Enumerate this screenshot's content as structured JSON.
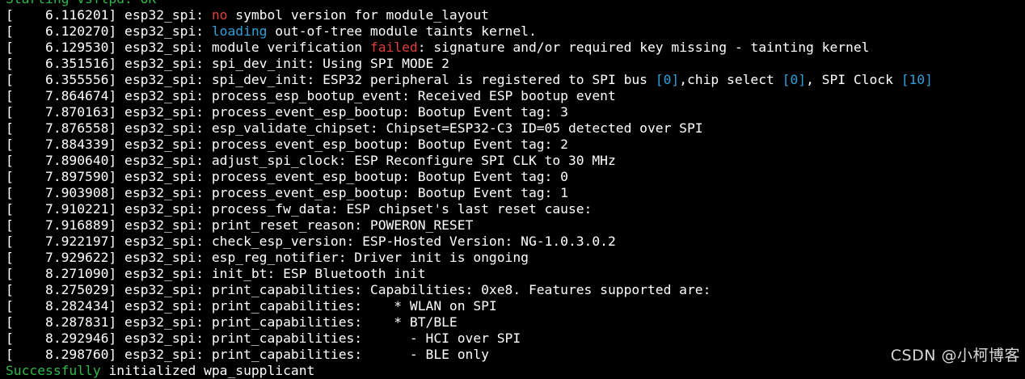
{
  "colors": {
    "background": "#000000",
    "text": "#ffffff",
    "error": "#e04040",
    "info": "#2ea0d8",
    "success": "#2fb84a"
  },
  "lines": [
    [
      {
        "t": "Starting vsftpd: ",
        "c": "green"
      },
      {
        "t": "OK",
        "c": "green"
      }
    ],
    [
      {
        "t": "[    6.116201] esp32_spi: ",
        "c": "normal"
      },
      {
        "t": "no",
        "c": "red"
      },
      {
        "t": " symbol version for module_layout",
        "c": "normal"
      }
    ],
    [
      {
        "t": "[    6.120270] esp32_spi: ",
        "c": "normal"
      },
      {
        "t": "loading",
        "c": "blue"
      },
      {
        "t": " out-of-tree module taints kernel.",
        "c": "normal"
      }
    ],
    [
      {
        "t": "[    6.129530] esp32_spi: module verification ",
        "c": "normal"
      },
      {
        "t": "failed",
        "c": "red"
      },
      {
        "t": ": signature and/or required key missing - tainting kernel",
        "c": "normal"
      }
    ],
    [
      {
        "t": "[    6.351516] esp32_spi: spi_dev_init: Using SPI MODE 2",
        "c": "normal"
      }
    ],
    [
      {
        "t": "[    6.355556] esp32_spi: spi_dev_init: ESP32 peripheral is registered to SPI bus ",
        "c": "normal"
      },
      {
        "t": "[0]",
        "c": "blue"
      },
      {
        "t": ",chip select ",
        "c": "normal"
      },
      {
        "t": "[0]",
        "c": "blue"
      },
      {
        "t": ", SPI Clock ",
        "c": "normal"
      },
      {
        "t": "[10]",
        "c": "blue"
      }
    ],
    [
      {
        "t": "[    7.864674] esp32_spi: process_esp_bootup_event: Received ESP bootup event",
        "c": "normal"
      }
    ],
    [
      {
        "t": "[    7.870163] esp32_spi: process_event_esp_bootup: Bootup Event tag: 3",
        "c": "normal"
      }
    ],
    [
      {
        "t": "[    7.876558] esp32_spi: esp_validate_chipset: Chipset=ESP32-C3 ID=05 detected over SPI",
        "c": "normal"
      }
    ],
    [
      {
        "t": "[    7.884339] esp32_spi: process_event_esp_bootup: Bootup Event tag: 2",
        "c": "normal"
      }
    ],
    [
      {
        "t": "[    7.890640] esp32_spi: adjust_spi_clock: ESP Reconfigure SPI CLK to 30 MHz",
        "c": "normal"
      }
    ],
    [
      {
        "t": "[    7.897590] esp32_spi: process_event_esp_bootup: Bootup Event tag: 0",
        "c": "normal"
      }
    ],
    [
      {
        "t": "[    7.903908] esp32_spi: process_event_esp_bootup: Bootup Event tag: 1",
        "c": "normal"
      }
    ],
    [
      {
        "t": "[    7.910221] esp32_spi: process_fw_data: ESP chipset's last reset cause:",
        "c": "normal"
      }
    ],
    [
      {
        "t": "[    7.916889] esp32_spi: print_reset_reason: POWERON_RESET",
        "c": "normal"
      }
    ],
    [
      {
        "t": "[    7.922197] esp32_spi: check_esp_version: ESP-Hosted Version: NG-1.0.3.0.2",
        "c": "normal"
      }
    ],
    [
      {
        "t": "[    7.929622] esp32_spi: esp_reg_notifier: Driver init is ongoing",
        "c": "normal"
      }
    ],
    [
      {
        "t": "[    8.271090] esp32_spi: init_bt: ESP Bluetooth init",
        "c": "normal"
      }
    ],
    [
      {
        "t": "[    8.275029] esp32_spi: print_capabilities: Capabilities: 0xe8. Features supported are:",
        "c": "normal"
      }
    ],
    [
      {
        "t": "[    8.282434] esp32_spi: print_capabilities:    * WLAN on SPI",
        "c": "normal"
      }
    ],
    [
      {
        "t": "[    8.287831] esp32_spi: print_capabilities:    * BT/BLE",
        "c": "normal"
      }
    ],
    [
      {
        "t": "[    8.292946] esp32_spi: print_capabilities:      - HCI over SPI",
        "c": "normal"
      }
    ],
    [
      {
        "t": "[    8.298760] esp32_spi: print_capabilities:      - BLE only",
        "c": "normal"
      }
    ],
    [
      {
        "t": "Successfully",
        "c": "green"
      },
      {
        "t": " initialized wpa_supplicant",
        "c": "normal"
      }
    ]
  ],
  "watermark": "CSDN @小柯博客"
}
